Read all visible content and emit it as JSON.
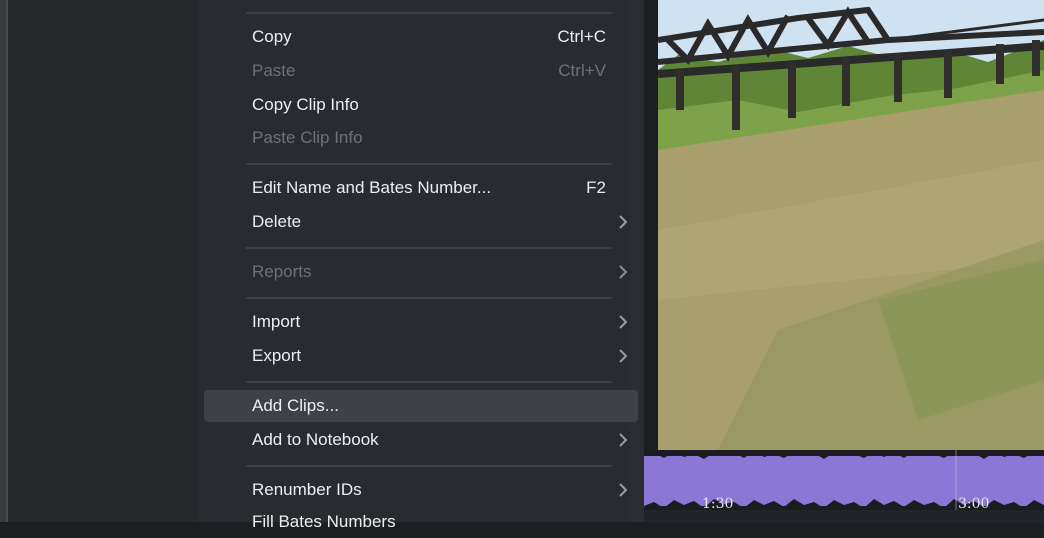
{
  "menu": {
    "items": [
      {
        "label": "Copy",
        "shortcut": "Ctrl+C",
        "enabled": true
      },
      {
        "label": "Paste",
        "shortcut": "Ctrl+V",
        "enabled": false
      },
      {
        "label": "Copy Clip Info",
        "enabled": true
      },
      {
        "label": "Paste Clip Info",
        "enabled": false
      },
      {
        "label": "Edit Name and Bates Number...",
        "shortcut": "F2",
        "enabled": true
      },
      {
        "label": "Delete",
        "submenu": true,
        "enabled": true
      },
      {
        "label": "Reports",
        "submenu": true,
        "enabled": false
      },
      {
        "label": "Import",
        "submenu": true,
        "enabled": true
      },
      {
        "label": "Export",
        "submenu": true,
        "enabled": true
      },
      {
        "label": "Add Clips...",
        "enabled": true,
        "highlighted": true
      },
      {
        "label": "Add to Notebook",
        "submenu": true,
        "enabled": true
      },
      {
        "label": "Renumber IDs",
        "submenu": true,
        "enabled": true
      },
      {
        "label": "Fill Bates Numbers",
        "enabled": true
      }
    ]
  },
  "timeline": {
    "ticks": [
      "1:30",
      "3:00"
    ]
  },
  "colors": {
    "menu_bg": "#2a2b30",
    "highlight": "#404148",
    "waveform": "#8b78d6"
  }
}
